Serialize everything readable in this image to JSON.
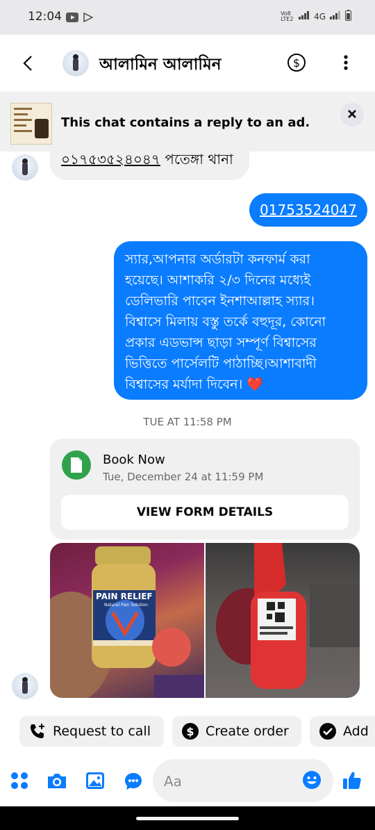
{
  "status_bar": {
    "time": "12:04",
    "network": "4G",
    "volte": "Vo8 LTE2"
  },
  "header": {
    "contact_name": "আলামিন আলামিন",
    "icons": [
      "back-arrow-icon",
      "dollar-circle-icon",
      "more-vertical-icon"
    ]
  },
  "ad_banner": {
    "text": "This chat contains a reply to an ad."
  },
  "messages": {
    "incoming_text": "০১৭৫৩৫২৪০৪৭",
    "incoming_suffix": " পতেঙ্গা থানা",
    "outgoing_phone": "01753524047",
    "outgoing_long_lines": [
      "স্যার,আপনার অর্ডারটা কনফার্ম করা",
      "হয়েছে। আশাকরি ২/৩ দিনের মধ্যেই",
      "ডেলিভারি পাবেন ইনশাআল্লাহ স্যার।",
      "বিশ্বাসে মিলায় বস্তু তর্কে বহুদূর, কোনো",
      "প্রকার এডভান্স ছাড়া সম্পূর্ণ বিশ্বাসের",
      "ভিত্তিতে পার্সেলটি পাঠাচ্ছি।আশাবাদী",
      "বিশ্বাসের মর্যাদা দিবেন। ❤️"
    ],
    "timestamp": "TUE AT 11:58 PM"
  },
  "form_card": {
    "title": "Book Now",
    "subtitle": "Tue, December 24 at 11:59 PM",
    "button_label": "VIEW FORM DETAILS"
  },
  "photos": {
    "photo1_label": "PAIN RELIEF",
    "photo1_sub": "Natural Pain Solution"
  },
  "quick_actions": [
    {
      "label": "Request to call",
      "icon": "phone-plus-icon"
    },
    {
      "label": "Create order",
      "icon": "dollar-circle-icon"
    },
    {
      "label": "Add",
      "icon": "check-circle-icon"
    }
  ],
  "composer": {
    "placeholder": "Aa",
    "icons": [
      "apps-grid-icon",
      "camera-icon",
      "gallery-icon",
      "chat-bubble-icon",
      "emoji-icon",
      "thumbs-up-icon"
    ]
  },
  "colors": {
    "accent": "#0a7cff",
    "bubble_in": "#f0f0f0",
    "form_green": "#31a24c"
  }
}
